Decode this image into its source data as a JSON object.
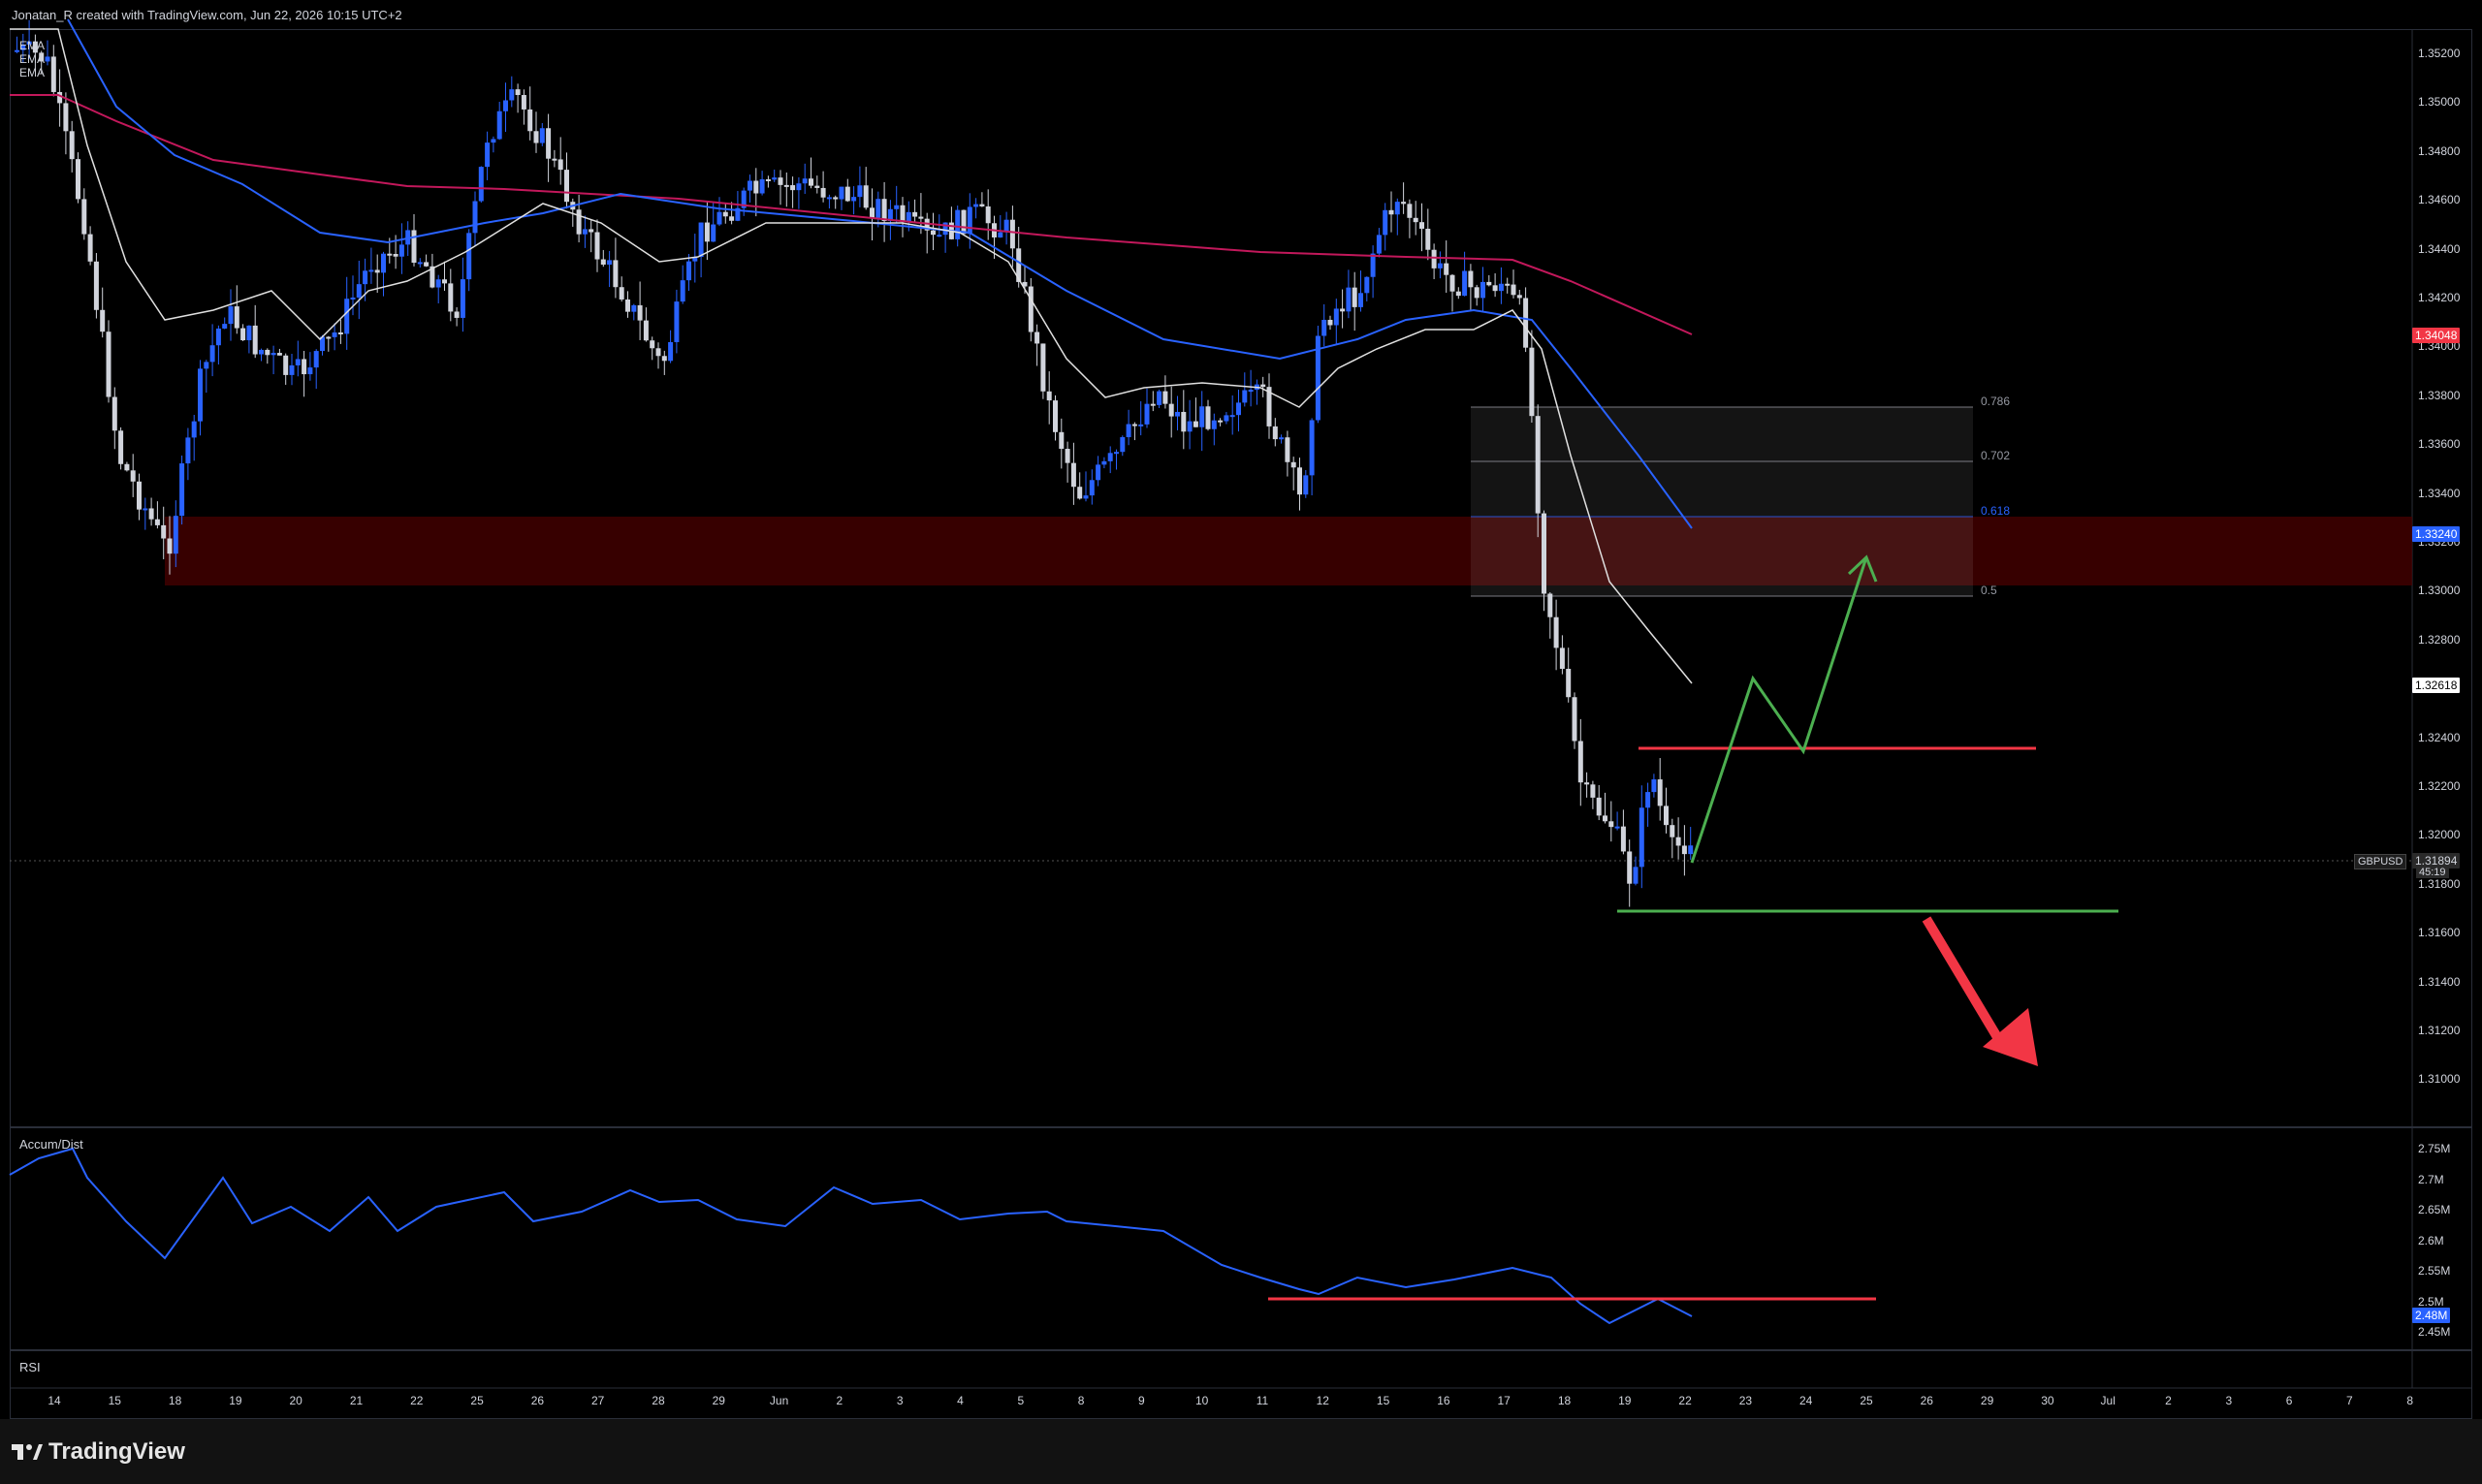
{
  "header": {
    "attribution": "Jonatan_R created with TradingView.com, Jun 22, 2026 10:15 UTC+2"
  },
  "chart": {
    "symbol": "GBPUSD",
    "legend": [
      "EMA",
      "EMA",
      "EMA"
    ],
    "last_price": "1.31894",
    "countdown": "45:19",
    "badges": [
      {
        "value": "1.34048",
        "color": "#f23645",
        "text_color": "#ffffff"
      },
      {
        "value": "1.33240",
        "color": "#2962ff",
        "text_color": "#ffffff"
      },
      {
        "value": "1.32618",
        "color": "#ffffff",
        "text_color": "#000000"
      }
    ],
    "price_ticks": [
      "1.35200",
      "1.35000",
      "1.34800",
      "1.34600",
      "1.34400",
      "1.34200",
      "1.34000",
      "1.33800",
      "1.33600",
      "1.33400",
      "1.33200",
      "1.33000",
      "1.32800",
      "1.32600",
      "1.32400",
      "1.32200",
      "1.32000",
      "1.31800",
      "1.31600",
      "1.31400",
      "1.31200",
      "1.31000"
    ],
    "fib_levels": [
      {
        "label": "0.786",
        "color": "#9598a1"
      },
      {
        "label": "0.702",
        "color": "#9598a1"
      },
      {
        "label": "0.618",
        "color": "#2962ff"
      },
      {
        "label": "0.5",
        "color": "#9598a1"
      }
    ],
    "colors": {
      "bull": "#2962ff",
      "bear": "#d1d4dc",
      "ema_fast": "#e0e0e0",
      "ema_mid": "#2962ff",
      "ema_slow": "#c2185b",
      "zone": "#4a0000",
      "resistance_line": "#f23645",
      "support_line": "#4caf50"
    }
  },
  "indicators": {
    "accum_dist": {
      "title": "Accum/Dist",
      "value": "2.48M",
      "ticks": [
        "2.75M",
        "2.7M",
        "2.65M",
        "2.6M",
        "2.55M",
        "2.5M",
        "2.45M"
      ]
    },
    "rsi": {
      "title": "RSI"
    }
  },
  "time_axis": [
    "14",
    "15",
    "18",
    "19",
    "20",
    "21",
    "22",
    "25",
    "26",
    "27",
    "28",
    "29",
    "Jun",
    "2",
    "3",
    "4",
    "5",
    "8",
    "9",
    "10",
    "11",
    "12",
    "15",
    "16",
    "17",
    "18",
    "19",
    "22",
    "23",
    "24",
    "25",
    "26",
    "29",
    "30",
    "Jul",
    "2",
    "3",
    "6",
    "7",
    "8"
  ],
  "footer": {
    "brand": "TradingView"
  }
}
